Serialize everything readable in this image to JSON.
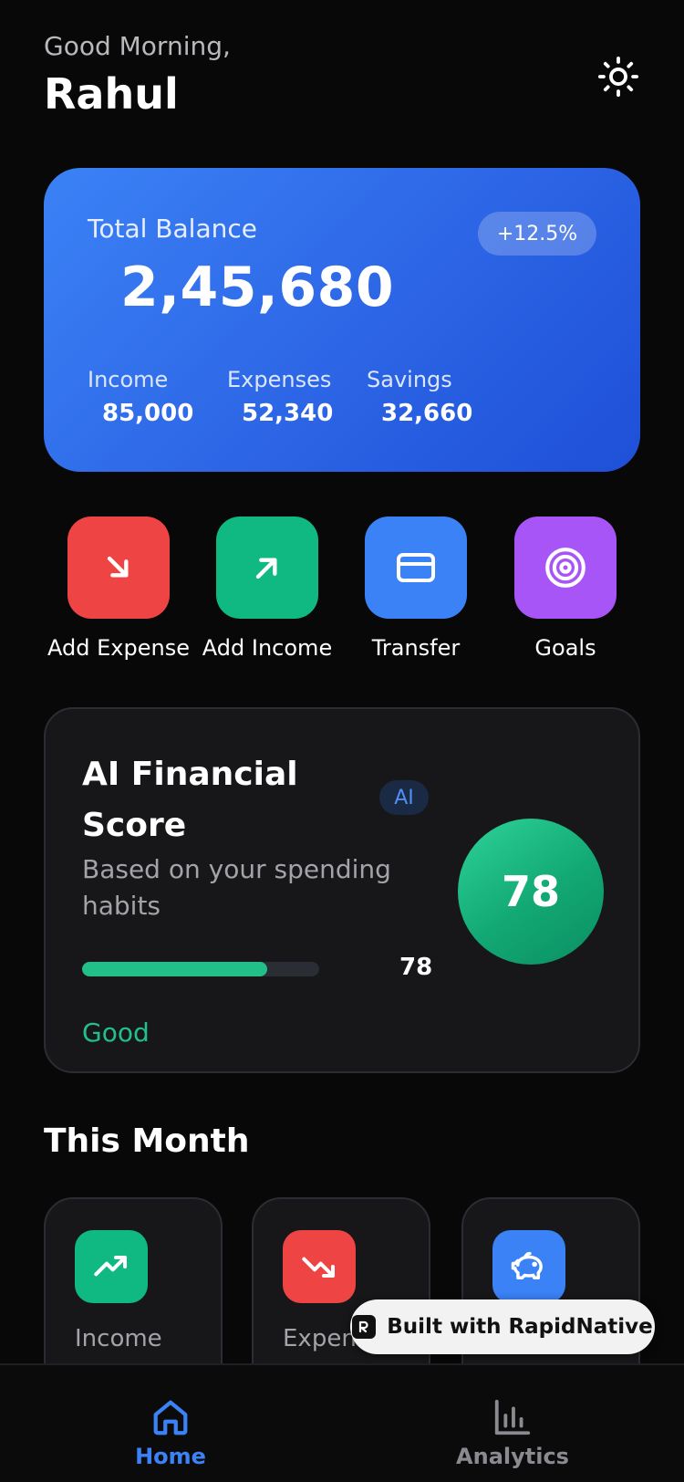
{
  "header": {
    "greeting": "Good Morning,",
    "name": "Rahul",
    "theme_icon": "sun-icon"
  },
  "balance": {
    "label": "Total Balance",
    "amount": "2,45,680",
    "change": "+12.5%",
    "stats": [
      {
        "label": "Income",
        "value": "85,000"
      },
      {
        "label": "Expenses",
        "value": "52,340"
      },
      {
        "label": "Savings",
        "value": "32,660"
      }
    ],
    "gradient_colors": [
      "#3b82f6",
      "#1e4fd8"
    ]
  },
  "actions": [
    {
      "label": "Add Expense",
      "icon": "arrow-down-right-icon",
      "color": "#ef4444"
    },
    {
      "label": "Add Income",
      "icon": "arrow-up-right-icon",
      "color": "#10b981"
    },
    {
      "label": "Transfer",
      "icon": "credit-card-icon",
      "color": "#3b82f6"
    },
    {
      "label": "Goals",
      "icon": "target-icon",
      "color": "#a855f7"
    }
  ],
  "ai_score": {
    "title": "AI Financial Score",
    "badge": "AI",
    "subtitle": "Based on your spending habits",
    "score": "78",
    "progress_percent": 78,
    "rating": "Good",
    "accent_color": "#22c088"
  },
  "this_month": {
    "title": "This Month",
    "cards": [
      {
        "label": "Income",
        "icon": "trending-up-icon",
        "color": "#10b981"
      },
      {
        "label": "Expenses",
        "icon": "trending-down-icon",
        "color": "#ef4444"
      },
      {
        "label": "",
        "icon": "piggy-bank-icon",
        "color": "#3b82f6"
      }
    ]
  },
  "built_badge": {
    "text": "Built with RapidNative"
  },
  "bottom_nav": {
    "items": [
      {
        "label": "Home",
        "icon": "home-icon",
        "active": true
      },
      {
        "label": "Analytics",
        "icon": "bar-chart-icon",
        "active": false
      }
    ],
    "active_color": "#3b82f6",
    "inactive_color": "#8a8a90"
  }
}
